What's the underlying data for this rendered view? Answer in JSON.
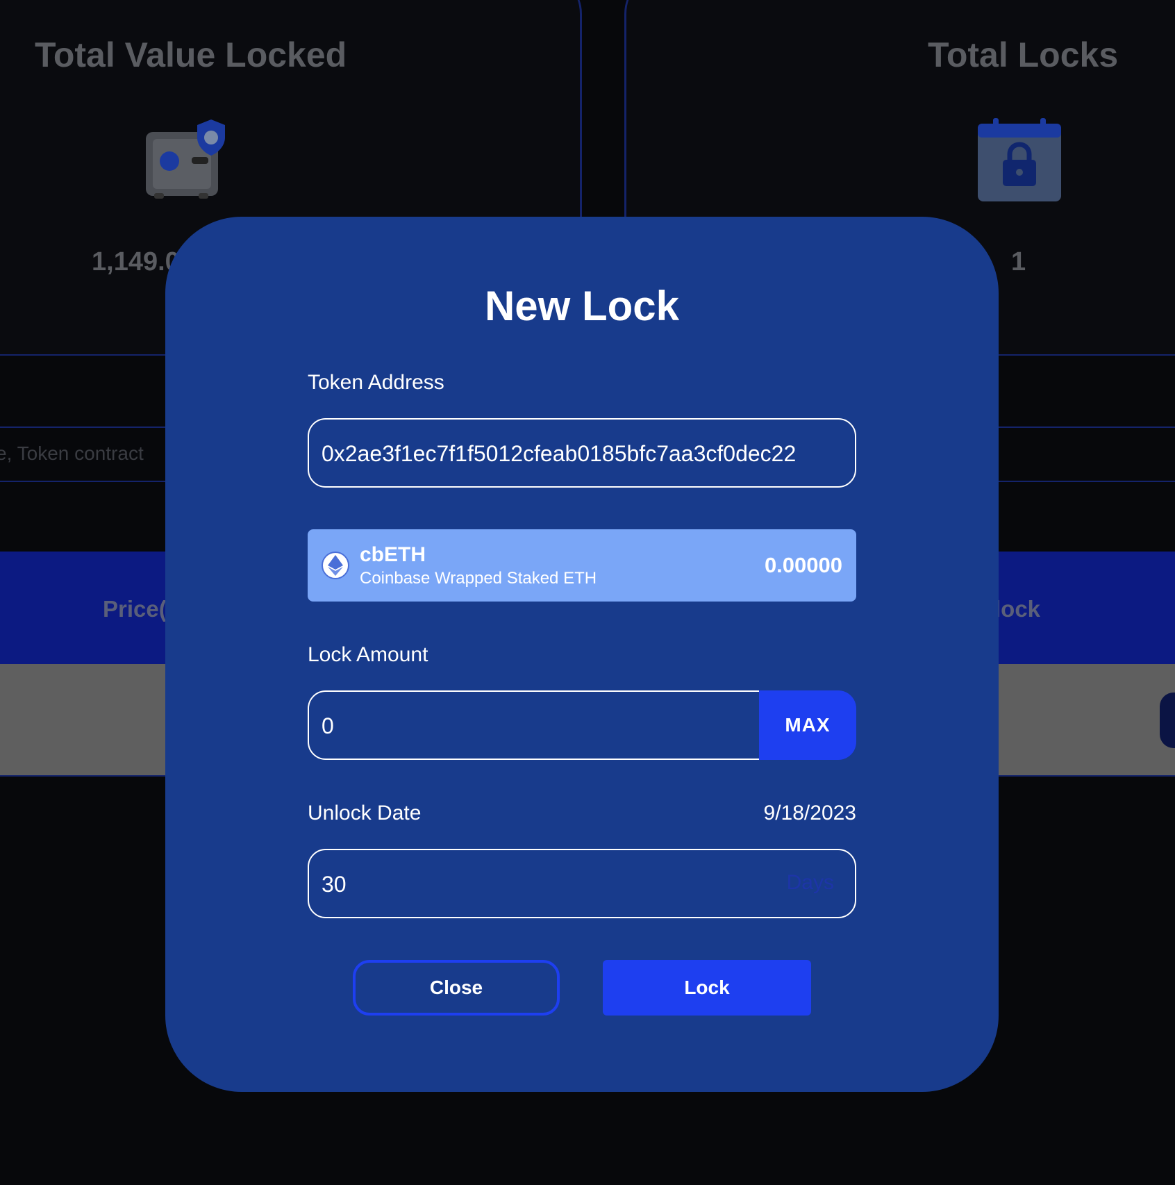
{
  "background": {
    "stats": [
      {
        "title": "Total Value Locked",
        "value": "1,149.0",
        "icon": "safe-icon"
      },
      {
        "title": "Total Locks",
        "value": "1",
        "icon": "calendar-lock-icon"
      }
    ],
    "search_placeholder": "e, Token contract",
    "table_headers": {
      "left": "Price(",
      "right": "lock"
    }
  },
  "modal": {
    "title": "New Lock",
    "token_address": {
      "label": "Token Address",
      "value": "0x2ae3f1ec7f1f5012cfeab0185bfc7aa3cf0dec22"
    },
    "token": {
      "symbol": "cbETH",
      "name": "Coinbase Wrapped Staked ETH",
      "balance": "0.00000",
      "icon": "ethereum-icon"
    },
    "lock_amount": {
      "label": "Lock Amount",
      "value": "0",
      "max_label": "MAX"
    },
    "unlock_date": {
      "label": "Unlock Date",
      "date": "9/18/2023",
      "value": "30",
      "suffix": "Days"
    },
    "buttons": {
      "close": "Close",
      "lock": "Lock"
    }
  },
  "colors": {
    "modal_bg": "#183b8c",
    "accent": "#1e3ff0",
    "token_card": "#7aa6f7"
  }
}
